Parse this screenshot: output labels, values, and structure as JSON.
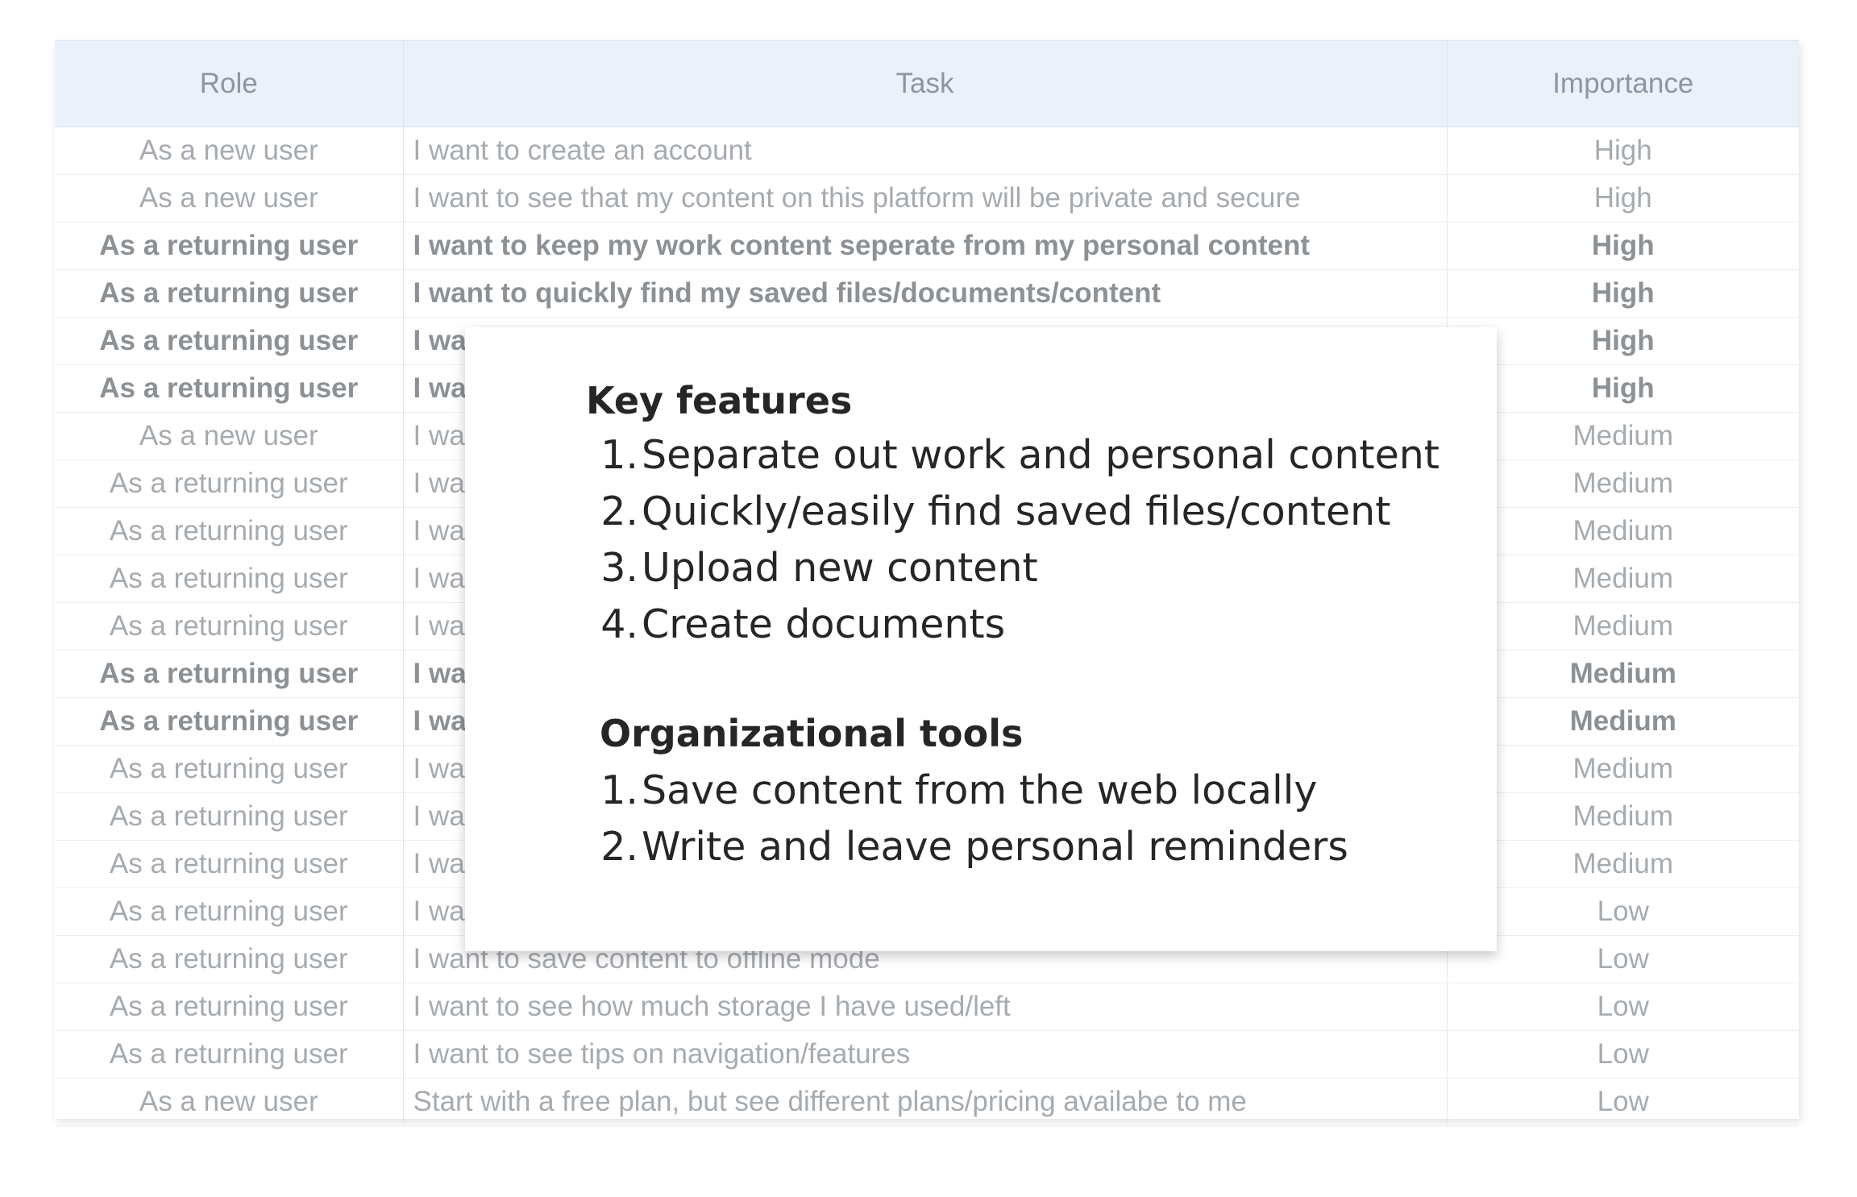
{
  "table": {
    "headers": {
      "role": "Role",
      "task": "Task",
      "importance": "Importance"
    },
    "rows": [
      {
        "role": "As a new user",
        "task": "I want to create an account",
        "importance": "High",
        "bold": false
      },
      {
        "role": "As a new user",
        "task": "I want to see that my content on this platform will be private and secure",
        "importance": "High",
        "bold": false
      },
      {
        "role": "As a returning user",
        "task": "I want to keep my work content seperate from my personal content",
        "importance": "High",
        "bold": true
      },
      {
        "role": "As a returning user",
        "task": "I want to quickly find my saved files/documents/content",
        "importance": "High",
        "bold": true
      },
      {
        "role": "As a returning user",
        "task": "I wa",
        "importance": "High",
        "bold": true
      },
      {
        "role": "As a returning user",
        "task": "I wa",
        "importance": "High",
        "bold": true
      },
      {
        "role": "As a new user",
        "task": "I wa",
        "importance": "Medium",
        "bold": false
      },
      {
        "role": "As a returning user",
        "task": "I wa",
        "importance": "Medium",
        "bold": false
      },
      {
        "role": "As a returning user",
        "task": "I wa",
        "importance": "Medium",
        "bold": false
      },
      {
        "role": "As a returning user",
        "task": "I wa",
        "importance": "Medium",
        "bold": false
      },
      {
        "role": "As a returning user",
        "task": "I wa",
        "importance": "Medium",
        "bold": false
      },
      {
        "role": "As a returning user",
        "task": "I wa",
        "importance": "Medium",
        "bold": true
      },
      {
        "role": "As a returning user",
        "task": "I wa",
        "importance": "Medium",
        "bold": true
      },
      {
        "role": "As a returning user",
        "task": "I wa",
        "importance": "Medium",
        "bold": false
      },
      {
        "role": "As a returning user",
        "task": "I wa",
        "importance": "Medium",
        "bold": false
      },
      {
        "role": "As a returning user",
        "task": "I wa",
        "importance": "Medium",
        "bold": false
      },
      {
        "role": "As a returning user",
        "task": "I wa",
        "importance": "Low",
        "bold": false
      },
      {
        "role": "As a returning user",
        "task": "I want to save content to offline mode",
        "importance": "Low",
        "bold": false
      },
      {
        "role": "As a returning user",
        "task": "I want to see how much storage I have used/left",
        "importance": "Low",
        "bold": false
      },
      {
        "role": "As a returning user",
        "task": "I want to see tips on navigation/features",
        "importance": "Low",
        "bold": false
      },
      {
        "role": "As a new user",
        "task": "Start with a free plan, but see different plans/pricing availabe to me",
        "importance": "Low",
        "bold": false
      }
    ]
  },
  "overlay": {
    "key_features": {
      "heading": "Key features",
      "items": [
        {
          "num": "1.",
          "text": "Separate out work and personal content"
        },
        {
          "num": "2.",
          "text": "Quickly/easily find saved files/content"
        },
        {
          "num": "3.",
          "text": "Upload new content"
        },
        {
          "num": "4.",
          "text": "Create documents"
        }
      ]
    },
    "organizational_tools": {
      "heading": "Organizational tools",
      "items": [
        {
          "num": "1.",
          "text": "Save content from the web locally"
        },
        {
          "num": "2.",
          "text": "Write and leave personal reminders"
        }
      ]
    }
  }
}
